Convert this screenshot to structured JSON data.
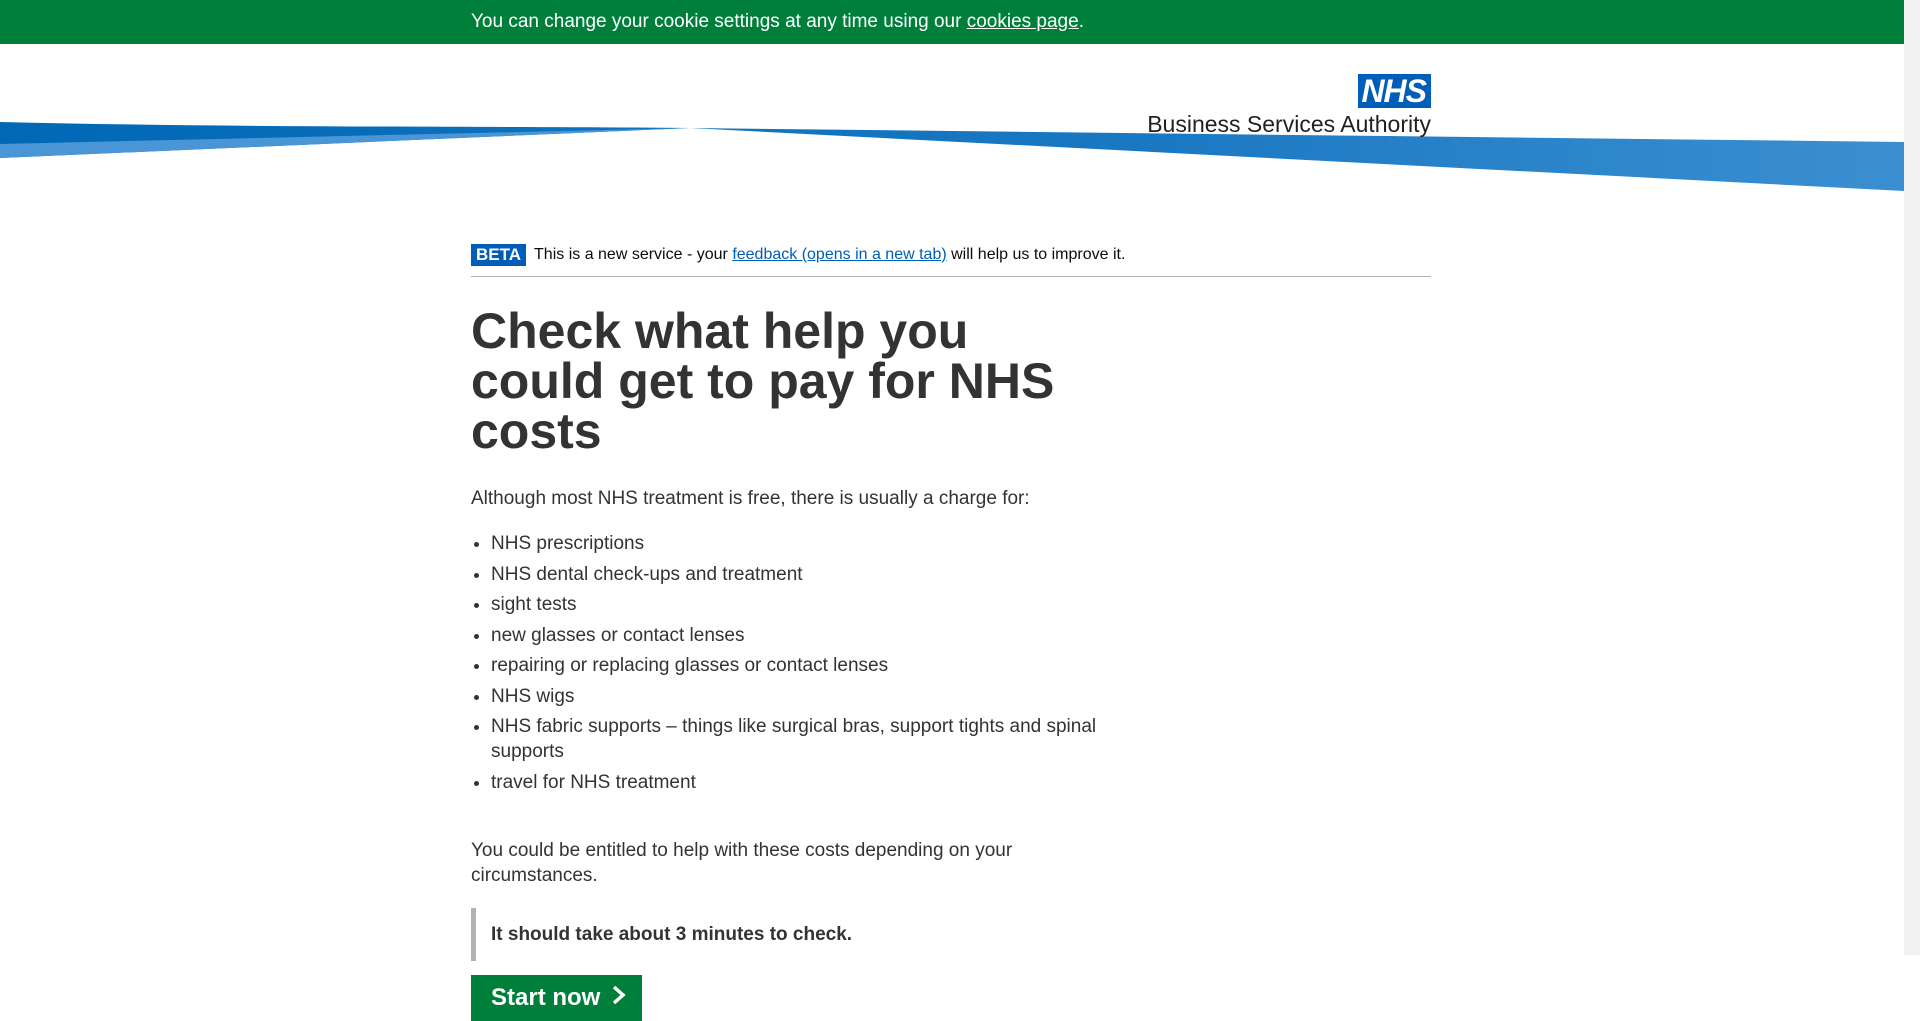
{
  "cookie_banner": {
    "text": "You can change your cookie settings at any time using our",
    "link_label": "cookies page",
    "suffix": "."
  },
  "header": {
    "logo_text": "NHS",
    "org_name": "Business Services Authority"
  },
  "phase_banner": {
    "tag": "BETA",
    "text_before": "This is a new service - your",
    "link_label": "feedback (opens in a new tab)",
    "text_after": "will help us to improve it."
  },
  "main": {
    "title": "Check what help you could get to pay for NHS costs",
    "lead": "Although most NHS treatment is free, there is usually a charge for:",
    "costs": [
      "NHS prescriptions",
      "NHS dental check-ups and treatment",
      "sight tests",
      "new glasses or contact lenses",
      "repairing or replacing glasses or contact lenses",
      "NHS wigs",
      "NHS fabric supports – things like surgical bras, support tights and spinal supports",
      "travel for NHS treatment"
    ],
    "entitled": "You could be entitled to help with these costs depending on your circumstances.",
    "inset": "It should take about 3 minutes to check.",
    "start_button": "Start now"
  },
  "colors": {
    "nhs_green": "#007f3b",
    "nhs_blue": "#005eb8",
    "text": "#333333"
  },
  "icons": {
    "start_button_icon": "chevron-right-icon",
    "logo": "nhs-logo"
  }
}
